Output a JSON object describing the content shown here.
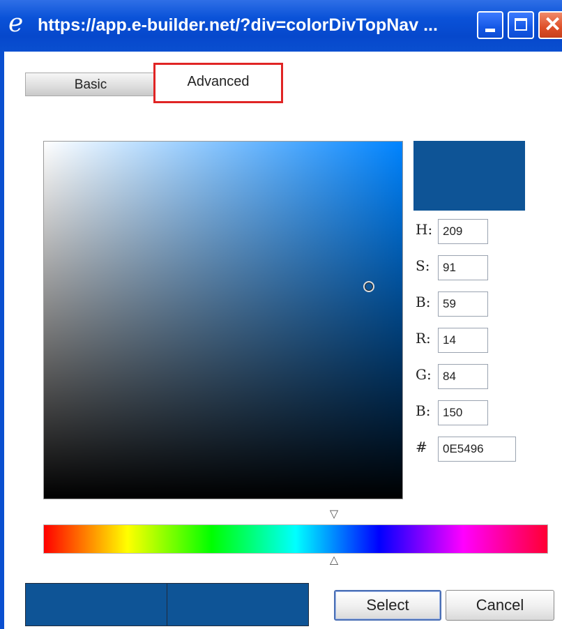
{
  "window": {
    "title": "https://app.e-builder.net/?div=colorDivTopNav ...",
    "browser_icon": "ie-icon",
    "minimize_icon": "minimize-icon",
    "maximize_icon": "maximize-icon",
    "close_icon": "close-icon",
    "title_bar_color": "#0a52d8"
  },
  "tabs": [
    {
      "label": "Basic",
      "active": false
    },
    {
      "label": "Advanced",
      "active": true
    }
  ],
  "color": {
    "preview_color": "#0E5496",
    "sv_base_hue_color": "#1a8cff",
    "fields": [
      {
        "key": "H",
        "label": "H:",
        "value": "209"
      },
      {
        "key": "S",
        "label": "S:",
        "value": "91"
      },
      {
        "key": "Bri",
        "label": "B:",
        "value": "59"
      },
      {
        "key": "R",
        "label": "R:",
        "value": "14"
      },
      {
        "key": "G",
        "label": "G:",
        "value": "84"
      },
      {
        "key": "Blue",
        "label": "B:",
        "value": "150"
      }
    ],
    "hex": {
      "label": "#",
      "value": "0E5496"
    }
  },
  "hue_marker_top_icon": "triangle-down-icon",
  "hue_marker_bottom_icon": "triangle-up-icon",
  "swatches": {
    "original_color": "#0E5496",
    "new_color": "#0E5496"
  },
  "buttons": {
    "select_label": "Select",
    "cancel_label": "Cancel"
  },
  "highlight_color": "#e02424"
}
